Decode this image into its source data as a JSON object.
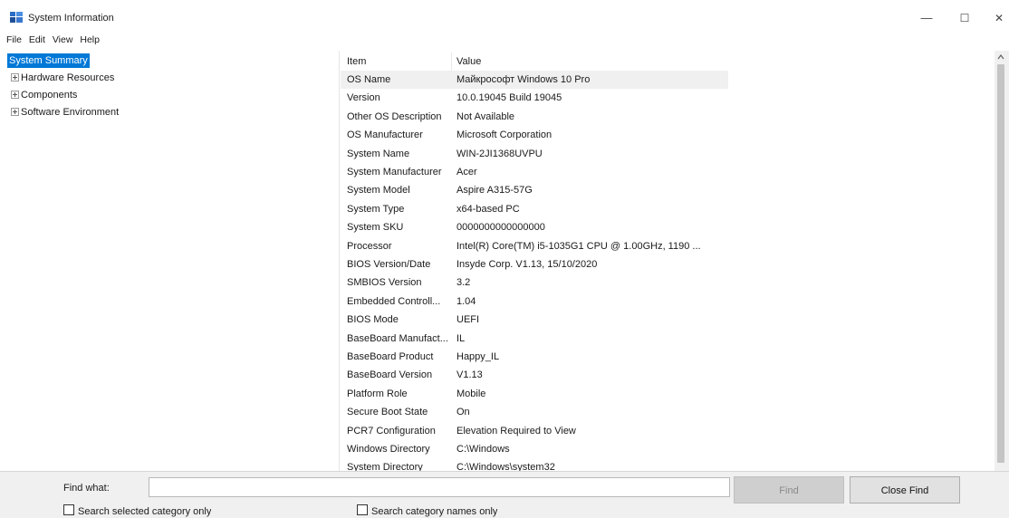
{
  "window": {
    "title": "System Information",
    "minimize": "—",
    "maximize": "☐",
    "close": "✕"
  },
  "menu": [
    "File",
    "Edit",
    "View",
    "Help"
  ],
  "tree": {
    "items": [
      {
        "label": "System Summary",
        "expandable": false,
        "selected": true
      },
      {
        "label": "Hardware Resources",
        "expandable": true,
        "selected": false
      },
      {
        "label": "Components",
        "expandable": true,
        "selected": false
      },
      {
        "label": "Software Environment",
        "expandable": true,
        "selected": false
      }
    ]
  },
  "grid": {
    "headers": {
      "item": "Item",
      "value": "Value"
    },
    "rows": [
      {
        "item": "OS Name",
        "value": "Майкрософт Windows 10 Pro"
      },
      {
        "item": "Version",
        "value": "10.0.19045 Build 19045"
      },
      {
        "item": "Other OS Description",
        "value": "Not Available"
      },
      {
        "item": "OS Manufacturer",
        "value": "Microsoft Corporation"
      },
      {
        "item": "System Name",
        "value": "WIN-2JI1368UVPU"
      },
      {
        "item": "System Manufacturer",
        "value": "Acer"
      },
      {
        "item": "System Model",
        "value": "Aspire A315-57G"
      },
      {
        "item": "System Type",
        "value": "x64-based PC"
      },
      {
        "item": "System SKU",
        "value": "0000000000000000"
      },
      {
        "item": "Processor",
        "value": "Intel(R) Core(TM) i5-1035G1 CPU @ 1.00GHz, 1190 ..."
      },
      {
        "item": "BIOS Version/Date",
        "value": "Insyde Corp. V1.13, 15/10/2020"
      },
      {
        "item": "SMBIOS Version",
        "value": "3.2"
      },
      {
        "item": "Embedded Controll...",
        "value": "1.04"
      },
      {
        "item": "BIOS Mode",
        "value": "UEFI"
      },
      {
        "item": "BaseBoard Manufact...",
        "value": "IL"
      },
      {
        "item": "BaseBoard Product",
        "value": "Happy_IL"
      },
      {
        "item": "BaseBoard Version",
        "value": "V1.13"
      },
      {
        "item": "Platform Role",
        "value": "Mobile"
      },
      {
        "item": "Secure Boot State",
        "value": "On"
      },
      {
        "item": "PCR7 Configuration",
        "value": "Elevation Required to View"
      },
      {
        "item": "Windows Directory",
        "value": "C:\\Windows"
      },
      {
        "item": "System Directory",
        "value": "C:\\Windows\\system32"
      }
    ]
  },
  "find": {
    "label": "Find what:",
    "value": "",
    "find_button": "Find",
    "close_button": "Close Find",
    "search_selected": "Search selected category only",
    "search_names": "Search category names only"
  },
  "colors": {
    "selection": "#0078d7",
    "highlight_row": "#f0f0f0",
    "findbar_bg": "#f0f0f0"
  }
}
